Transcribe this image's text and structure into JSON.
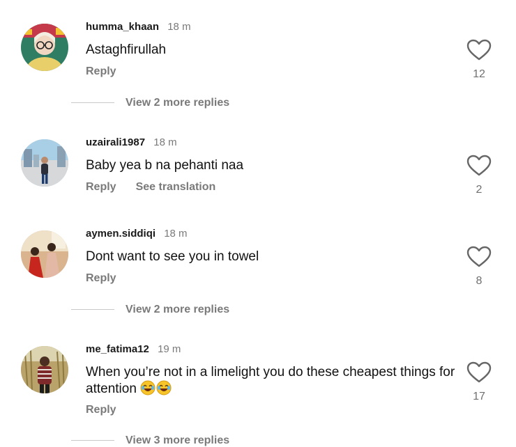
{
  "comments": [
    {
      "username": "humma_khaan",
      "time": "18 m",
      "text": "Astaghfirullah",
      "reply_label": "Reply",
      "translate_label": "",
      "likes": "12",
      "more_replies": "View 2 more replies",
      "avatar_icon": "profile-photo-woman-glasses"
    },
    {
      "username": "uzairali1987",
      "time": "18 m",
      "text": "Baby yea b na pehanti naa",
      "reply_label": "Reply",
      "translate_label": "See translation",
      "likes": "2",
      "more_replies": "",
      "avatar_icon": "profile-photo-man-outdoor"
    },
    {
      "username": "aymen.siddiqi",
      "time": "18 m",
      "text": "Dont want to see you in towel",
      "reply_label": "Reply",
      "translate_label": "",
      "likes": "8",
      "more_replies": "View 2 more replies",
      "avatar_icon": "profile-photo-two-women"
    },
    {
      "username": "me_fatima12",
      "time": "19 m",
      "text": "When you’re not in a limelight you do these cheapest things for attention",
      "emoji": "😂😂",
      "reply_label": "Reply",
      "translate_label": "",
      "likes": "17",
      "more_replies": "View 3 more replies",
      "avatar_icon": "profile-photo-woman-field"
    }
  ],
  "icons": {
    "like": "heart-outline-icon"
  },
  "colors": {
    "secondary_text": "#7a7a7a",
    "primary_text": "#111111"
  }
}
